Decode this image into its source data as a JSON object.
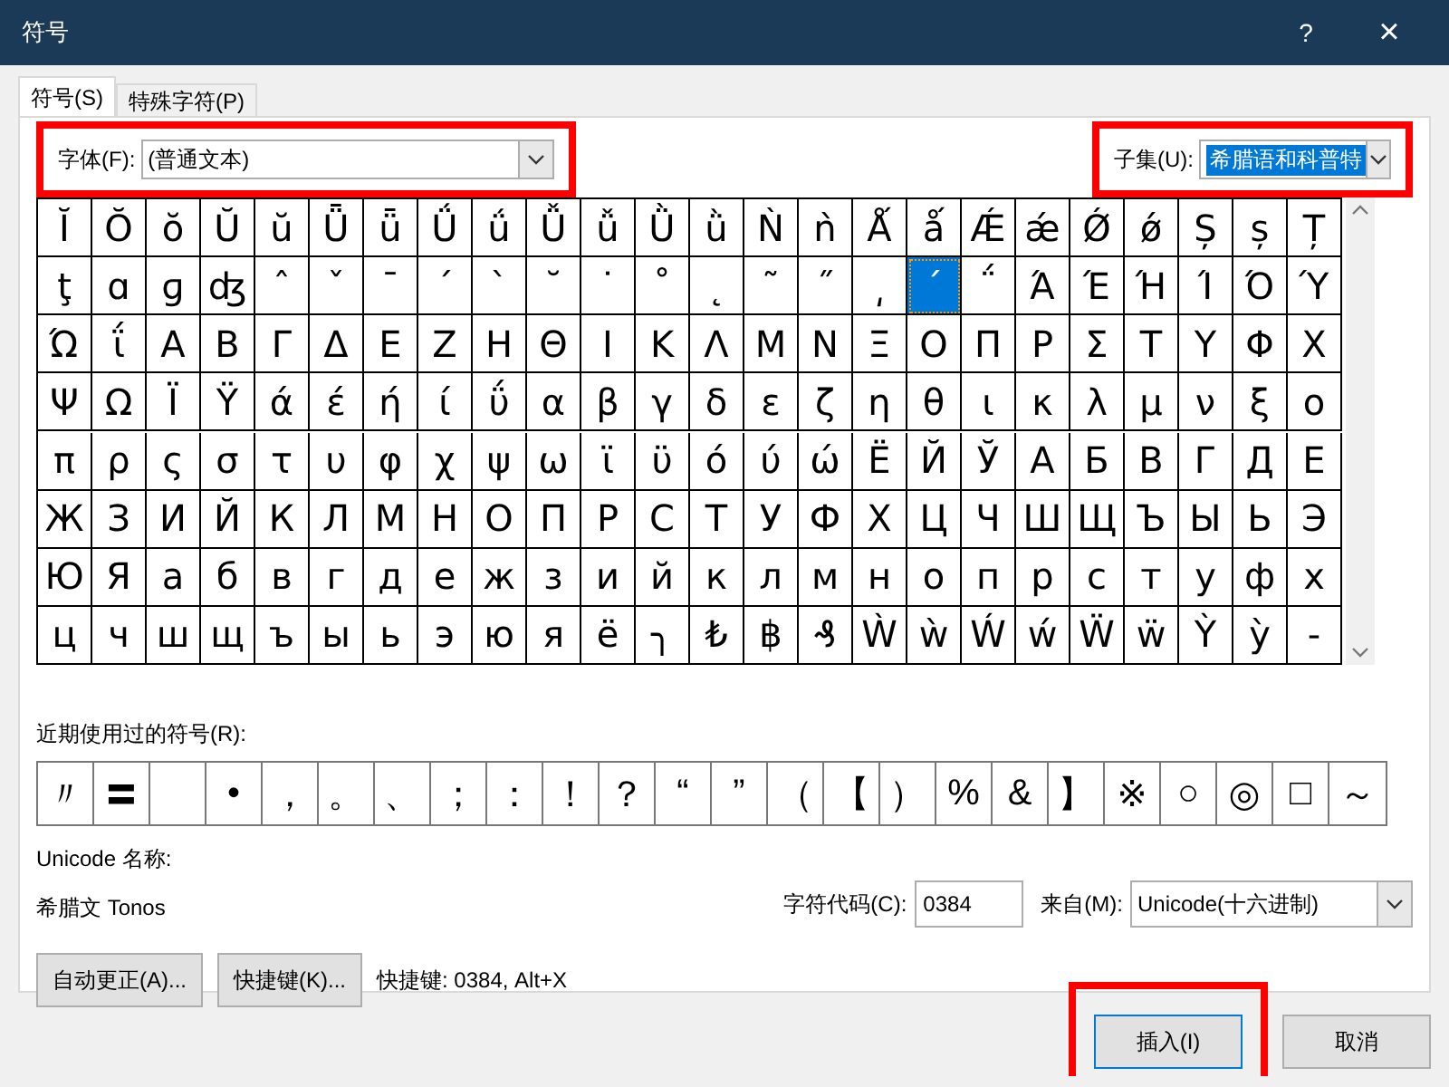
{
  "window": {
    "title": "符号",
    "help": "?",
    "close": "×"
  },
  "tabs": [
    {
      "label": "符号(S)",
      "selected": true
    },
    {
      "label": "特殊字符(P)",
      "selected": false
    }
  ],
  "font": {
    "label": "字体(F):",
    "value": "(普通文本)",
    "highlighted": true
  },
  "subset": {
    "label": "子集(U):",
    "value": "希腊语和科普特",
    "value_selected": true,
    "highlighted": true
  },
  "grid": {
    "rows": [
      [
        {
          "char": "Ĭ",
          "selected": false
        },
        {
          "char": "Ŏ",
          "selected": false
        },
        {
          "char": "ŏ",
          "selected": false
        },
        {
          "char": "Ŭ",
          "selected": false
        },
        {
          "char": "ŭ",
          "selected": false
        },
        {
          "char": "Ǖ",
          "selected": false
        },
        {
          "char": "ǖ",
          "selected": false
        },
        {
          "char": "Ǘ",
          "selected": false
        },
        {
          "char": "ǘ",
          "selected": false
        },
        {
          "char": "Ǚ",
          "selected": false
        },
        {
          "char": "ǚ",
          "selected": false
        },
        {
          "char": "Ǜ",
          "selected": false
        },
        {
          "char": "ǜ",
          "selected": false
        },
        {
          "char": "Ǹ",
          "selected": false
        },
        {
          "char": "ǹ",
          "selected": false
        },
        {
          "char": "Ǻ",
          "selected": false
        },
        {
          "char": "ǻ",
          "selected": false
        },
        {
          "char": "Ǽ",
          "selected": false
        },
        {
          "char": "ǽ",
          "selected": false
        },
        {
          "char": "Ǿ",
          "selected": false
        },
        {
          "char": "ǿ",
          "selected": false
        },
        {
          "char": "Ș",
          "selected": false
        },
        {
          "char": "ș",
          "selected": false
        },
        {
          "char": "Ț",
          "selected": false
        }
      ],
      [
        {
          "char": "ţ",
          "selected": false
        },
        {
          "char": "ɑ",
          "selected": false
        },
        {
          "char": "ɡ",
          "selected": false
        },
        {
          "char": "ʤ",
          "selected": false
        },
        {
          "char": "ˆ",
          "selected": false
        },
        {
          "char": "ˇ",
          "selected": false
        },
        {
          "char": "ˉ",
          "selected": false
        },
        {
          "char": "ˊ",
          "selected": false
        },
        {
          "char": "ˋ",
          "selected": false
        },
        {
          "char": "˘",
          "selected": false
        },
        {
          "char": "˙",
          "selected": false
        },
        {
          "char": "˚",
          "selected": false
        },
        {
          "char": "˛",
          "selected": false
        },
        {
          "char": "˜",
          "selected": false
        },
        {
          "char": "˝",
          "selected": false
        },
        {
          "char": "͵",
          "selected": false
        },
        {
          "char": "΄",
          "selected": true
        },
        {
          "char": "΅",
          "selected": false
        },
        {
          "char": "Ά",
          "selected": false
        },
        {
          "char": "Έ",
          "selected": false
        },
        {
          "char": "Ή",
          "selected": false
        },
        {
          "char": "Ί",
          "selected": false
        },
        {
          "char": "Ό",
          "selected": false
        },
        {
          "char": "Ύ",
          "selected": false
        }
      ],
      [
        {
          "char": "Ώ",
          "selected": false
        },
        {
          "char": "ΐ",
          "selected": false
        },
        {
          "char": "Α",
          "selected": false
        },
        {
          "char": "Β",
          "selected": false
        },
        {
          "char": "Γ",
          "selected": false
        },
        {
          "char": "Δ",
          "selected": false
        },
        {
          "char": "Ε",
          "selected": false
        },
        {
          "char": "Ζ",
          "selected": false
        },
        {
          "char": "Η",
          "selected": false
        },
        {
          "char": "Θ",
          "selected": false
        },
        {
          "char": "Ι",
          "selected": false
        },
        {
          "char": "Κ",
          "selected": false
        },
        {
          "char": "Λ",
          "selected": false
        },
        {
          "char": "Μ",
          "selected": false
        },
        {
          "char": "Ν",
          "selected": false
        },
        {
          "char": "Ξ",
          "selected": false
        },
        {
          "char": "Ο",
          "selected": false
        },
        {
          "char": "Π",
          "selected": false
        },
        {
          "char": "Ρ",
          "selected": false
        },
        {
          "char": "Σ",
          "selected": false
        },
        {
          "char": "Τ",
          "selected": false
        },
        {
          "char": "Υ",
          "selected": false
        },
        {
          "char": "Φ",
          "selected": false
        },
        {
          "char": "Χ",
          "selected": false
        }
      ],
      [
        {
          "char": "Ψ",
          "selected": false
        },
        {
          "char": "Ω",
          "selected": false
        },
        {
          "char": "Ϊ",
          "selected": false
        },
        {
          "char": "Ϋ",
          "selected": false
        },
        {
          "char": "ά",
          "selected": false
        },
        {
          "char": "έ",
          "selected": false
        },
        {
          "char": "ή",
          "selected": false
        },
        {
          "char": "ί",
          "selected": false
        },
        {
          "char": "ΰ",
          "selected": false
        },
        {
          "char": "α",
          "selected": false
        },
        {
          "char": "β",
          "selected": false
        },
        {
          "char": "γ",
          "selected": false
        },
        {
          "char": "δ",
          "selected": false
        },
        {
          "char": "ε",
          "selected": false
        },
        {
          "char": "ζ",
          "selected": false
        },
        {
          "char": "η",
          "selected": false
        },
        {
          "char": "θ",
          "selected": false
        },
        {
          "char": "ι",
          "selected": false
        },
        {
          "char": "κ",
          "selected": false
        },
        {
          "char": "λ",
          "selected": false
        },
        {
          "char": "μ",
          "selected": false
        },
        {
          "char": "ν",
          "selected": false
        },
        {
          "char": "ξ",
          "selected": false
        },
        {
          "char": "ο",
          "selected": false
        }
      ],
      [
        {
          "char": "π",
          "selected": false
        },
        {
          "char": "ρ",
          "selected": false
        },
        {
          "char": "ς",
          "selected": false
        },
        {
          "char": "σ",
          "selected": false
        },
        {
          "char": "τ",
          "selected": false
        },
        {
          "char": "υ",
          "selected": false
        },
        {
          "char": "φ",
          "selected": false
        },
        {
          "char": "χ",
          "selected": false
        },
        {
          "char": "ψ",
          "selected": false
        },
        {
          "char": "ω",
          "selected": false
        },
        {
          "char": "ϊ",
          "selected": false
        },
        {
          "char": "ϋ",
          "selected": false
        },
        {
          "char": "ό",
          "selected": false
        },
        {
          "char": "ύ",
          "selected": false
        },
        {
          "char": "ώ",
          "selected": false
        },
        {
          "char": "Ё",
          "selected": false
        },
        {
          "char": "Й",
          "selected": false
        },
        {
          "char": "Ў",
          "selected": false
        },
        {
          "char": "А",
          "selected": false
        },
        {
          "char": "Б",
          "selected": false
        },
        {
          "char": "В",
          "selected": false
        },
        {
          "char": "Г",
          "selected": false
        },
        {
          "char": "Д",
          "selected": false
        },
        {
          "char": "Е",
          "selected": false
        }
      ],
      [
        {
          "char": "Ж",
          "selected": false
        },
        {
          "char": "З",
          "selected": false
        },
        {
          "char": "И",
          "selected": false
        },
        {
          "char": "Й",
          "selected": false
        },
        {
          "char": "К",
          "selected": false
        },
        {
          "char": "Л",
          "selected": false
        },
        {
          "char": "М",
          "selected": false
        },
        {
          "char": "Н",
          "selected": false
        },
        {
          "char": "О",
          "selected": false
        },
        {
          "char": "П",
          "selected": false
        },
        {
          "char": "Р",
          "selected": false
        },
        {
          "char": "С",
          "selected": false
        },
        {
          "char": "Т",
          "selected": false
        },
        {
          "char": "У",
          "selected": false
        },
        {
          "char": "Ф",
          "selected": false
        },
        {
          "char": "Х",
          "selected": false
        },
        {
          "char": "Ц",
          "selected": false
        },
        {
          "char": "Ч",
          "selected": false
        },
        {
          "char": "Ш",
          "selected": false
        },
        {
          "char": "Щ",
          "selected": false
        },
        {
          "char": "Ъ",
          "selected": false
        },
        {
          "char": "Ы",
          "selected": false
        },
        {
          "char": "Ь",
          "selected": false
        },
        {
          "char": "Э",
          "selected": false
        }
      ],
      [
        {
          "char": "Ю",
          "selected": false
        },
        {
          "char": "Я",
          "selected": false
        },
        {
          "char": "а",
          "selected": false
        },
        {
          "char": "б",
          "selected": false
        },
        {
          "char": "в",
          "selected": false
        },
        {
          "char": "г",
          "selected": false
        },
        {
          "char": "д",
          "selected": false
        },
        {
          "char": "е",
          "selected": false
        },
        {
          "char": "ж",
          "selected": false
        },
        {
          "char": "з",
          "selected": false
        },
        {
          "char": "и",
          "selected": false
        },
        {
          "char": "й",
          "selected": false
        },
        {
          "char": "к",
          "selected": false
        },
        {
          "char": "л",
          "selected": false
        },
        {
          "char": "м",
          "selected": false
        },
        {
          "char": "н",
          "selected": false
        },
        {
          "char": "о",
          "selected": false
        },
        {
          "char": "п",
          "selected": false
        },
        {
          "char": "р",
          "selected": false
        },
        {
          "char": "с",
          "selected": false
        },
        {
          "char": "т",
          "selected": false
        },
        {
          "char": "у",
          "selected": false
        },
        {
          "char": "ф",
          "selected": false
        },
        {
          "char": "х",
          "selected": false
        }
      ],
      [
        {
          "char": "ц",
          "selected": false
        },
        {
          "char": "ч",
          "selected": false
        },
        {
          "char": "ш",
          "selected": false
        },
        {
          "char": "щ",
          "selected": false
        },
        {
          "char": "ъ",
          "selected": false
        },
        {
          "char": "ы",
          "selected": false
        },
        {
          "char": "ь",
          "selected": false
        },
        {
          "char": "э",
          "selected": false
        },
        {
          "char": "ю",
          "selected": false
        },
        {
          "char": "я",
          "selected": false
        },
        {
          "char": "ё",
          "selected": false
        },
        {
          "char": "╮",
          "selected": false
        },
        {
          "char": "₺",
          "selected": false
        },
        {
          "char": "฿",
          "selected": false
        },
        {
          "char": "₰",
          "selected": false
        },
        {
          "char": "Ẁ",
          "selected": false
        },
        {
          "char": "ẁ",
          "selected": false
        },
        {
          "char": "Ẃ",
          "selected": false
        },
        {
          "char": "ẃ",
          "selected": false
        },
        {
          "char": "Ẅ",
          "selected": false
        },
        {
          "char": "ẅ",
          "selected": false
        },
        {
          "char": "Ỳ",
          "selected": false
        },
        {
          "char": "ỳ",
          "selected": false
        },
        {
          "char": "‐",
          "selected": false
        }
      ]
    ]
  },
  "recent": {
    "label": "近期使用过的符号(R):",
    "items": [
      {
        "kind": "symbol",
        "char": "〃"
      },
      {
        "kind": "symbol",
        "char": "〓"
      },
      {
        "kind": "blank"
      },
      {
        "kind": "symbol",
        "char": "•"
      },
      {
        "kind": "symbol",
        "char": "，"
      },
      {
        "kind": "symbol",
        "char": "。"
      },
      {
        "kind": "symbol",
        "char": "、"
      },
      {
        "kind": "symbol",
        "char": "；"
      },
      {
        "kind": "symbol",
        "char": "："
      },
      {
        "kind": "symbol",
        "char": "！"
      },
      {
        "kind": "symbol",
        "char": "？"
      },
      {
        "kind": "symbol",
        "char": "“"
      },
      {
        "kind": "symbol",
        "char": "”"
      },
      {
        "kind": "symbol",
        "char": "（"
      },
      {
        "kind": "symbol",
        "char": "【"
      },
      {
        "kind": "symbol",
        "char": "）"
      },
      {
        "kind": "symbol",
        "char": "%"
      },
      {
        "kind": "symbol",
        "char": "&"
      },
      {
        "kind": "symbol",
        "char": "】"
      },
      {
        "kind": "symbol",
        "char": "※"
      },
      {
        "kind": "symbol",
        "char": "○"
      },
      {
        "kind": "symbol",
        "char": "◎"
      },
      {
        "kind": "symbol",
        "char": "□"
      },
      {
        "kind": "symbol",
        "char": "～"
      }
    ]
  },
  "unicode_name": {
    "label": "Unicode 名称:",
    "value": "希腊文 Tonos"
  },
  "char_code": {
    "label": "字符代码(C):",
    "value": "0384"
  },
  "from": {
    "label": "来自(M):",
    "value": "Unicode(十六进制)"
  },
  "autocorrect_button": {
    "label": "自动更正(A)..."
  },
  "shortcut_button": {
    "label": "快捷键(K)..."
  },
  "shortcut_text": "快捷键: 0384, Alt+X",
  "buttons": [
    {
      "label": "插入(I)",
      "kind": "default",
      "highlighted": true
    },
    {
      "label": "取消",
      "kind": "normal"
    }
  ]
}
